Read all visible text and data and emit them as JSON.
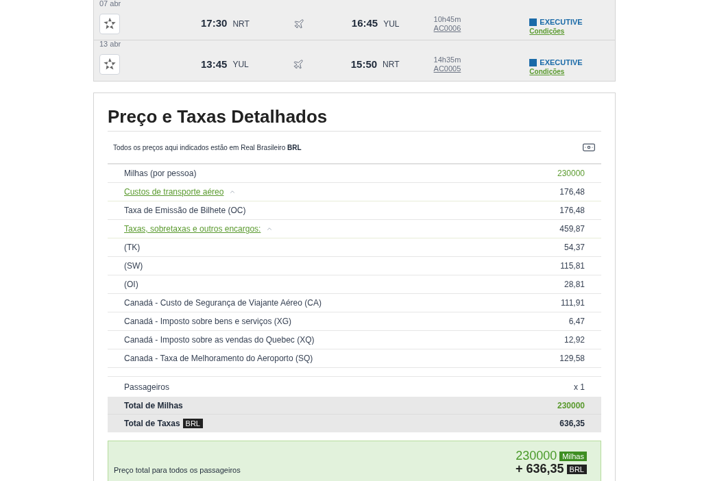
{
  "flights": [
    {
      "date": "07 abr",
      "dep_time": "17:30",
      "dep_airport": "NRT",
      "arr_time": "16:45",
      "arr_airport": "YUL",
      "duration": "10h45m",
      "flight_number": "AC0006",
      "cabin": "EXECUTIVE",
      "conditions": "Condições"
    },
    {
      "date": "13 abr",
      "dep_time": "13:45",
      "dep_airport": "YUL",
      "arr_time": "15:50",
      "arr_airport": "NRT",
      "duration": "14h35m",
      "flight_number": "AC0005",
      "cabin": "EXECUTIVE",
      "conditions": "Condições"
    }
  ],
  "details": {
    "title": "Preço e Taxas Detalhados",
    "currency_note": "Todos os preços aqui indicados estão em Real Brasileiro **BRL**",
    "rows": [
      {
        "kind": "miles",
        "label": "Milhas (por pessoa)",
        "value": "230000"
      },
      {
        "kind": "group",
        "label": "Custos de transporte aéreo",
        "value": "176,48",
        "expanded": true
      },
      {
        "kind": "item",
        "label": "Taxa de Emissão de Bilhete (OC)",
        "value": "176,48"
      },
      {
        "kind": "group",
        "label": "Taxas, sobretaxas e outros encargos:",
        "value": "459,87",
        "expanded": true
      },
      {
        "kind": "item",
        "label": "(TK)",
        "value": "54,37"
      },
      {
        "kind": "item",
        "label": "(SW)",
        "value": "115,81"
      },
      {
        "kind": "item",
        "label": "(OI)",
        "value": "28,81"
      },
      {
        "kind": "item",
        "label": "Canadá - Custo de Segurança de Viajante Aéreo (CA)",
        "value": "111,91"
      },
      {
        "kind": "item",
        "label": "Canadá - Imposto sobre bens e serviços (XG)",
        "value": "6,47"
      },
      {
        "kind": "item",
        "label": "Canadá - Imposto sobre as vendas do Quebec (XQ)",
        "value": "12,92"
      },
      {
        "kind": "item",
        "label": "Canada - Taxa de Melhoramento do Aeroporto (SQ)",
        "value": "129,58"
      }
    ],
    "passengers": {
      "label": "Passageiros",
      "value": "x 1"
    },
    "total_miles": {
      "label": "Total de Milhas",
      "value": "230000"
    },
    "total_taxes": {
      "label": "Total de Taxas",
      "badge": "BRL",
      "value": "636,35"
    },
    "grand_total": {
      "label": "Preço total para todos os passageiros",
      "miles": "230000",
      "miles_badge": "Milhas",
      "taxes": "+ 636,35",
      "taxes_badge": "BRL"
    }
  }
}
